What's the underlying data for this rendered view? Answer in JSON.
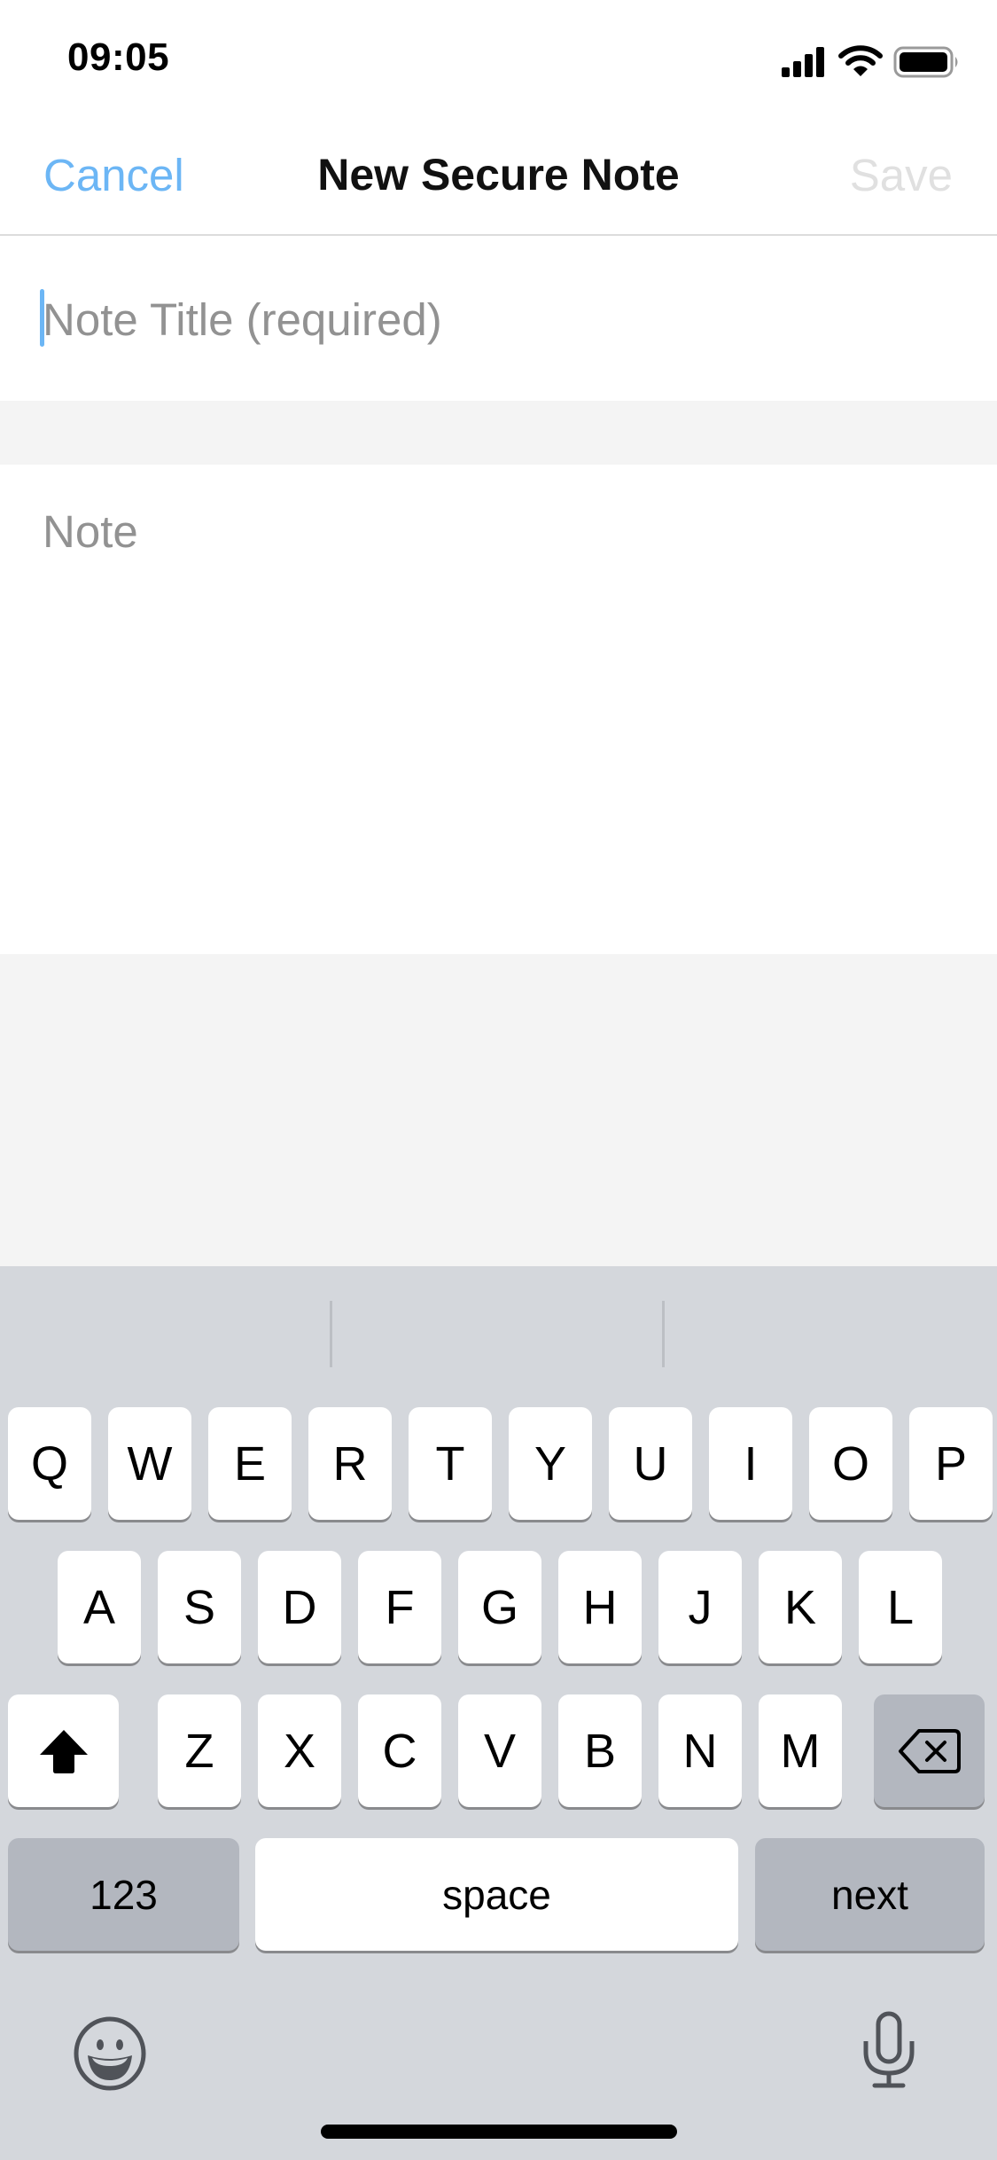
{
  "status_bar": {
    "time": "09:05",
    "icons": [
      "cellular-signal-icon",
      "wifi-icon",
      "battery-icon"
    ]
  },
  "nav": {
    "cancel_label": "Cancel",
    "title": "New Secure Note",
    "save_label": "Save",
    "save_enabled": false
  },
  "form": {
    "title_field": {
      "value": "",
      "placeholder": "Note Title (required)",
      "focused": true
    },
    "note_field": {
      "value": "",
      "placeholder": "Note"
    }
  },
  "keyboard": {
    "rows": [
      [
        "Q",
        "W",
        "E",
        "R",
        "T",
        "Y",
        "U",
        "I",
        "O",
        "P"
      ],
      [
        "A",
        "S",
        "D",
        "F",
        "G",
        "H",
        "J",
        "K",
        "L"
      ],
      [
        "Z",
        "X",
        "C",
        "V",
        "B",
        "N",
        "M"
      ]
    ],
    "shift_active": true,
    "numbers_label": "123",
    "space_label": "space",
    "return_label": "next",
    "icons": {
      "shift": "shift-icon",
      "delete": "delete-icon",
      "emoji": "emoji-icon",
      "mic": "microphone-icon"
    }
  },
  "colors": {
    "accent": "#6cb6f5",
    "disabled": "#e0e0e0",
    "placeholder": "#929292",
    "keyboard_bg": "#d4d7dc",
    "special_key": "#b3b7bf"
  }
}
